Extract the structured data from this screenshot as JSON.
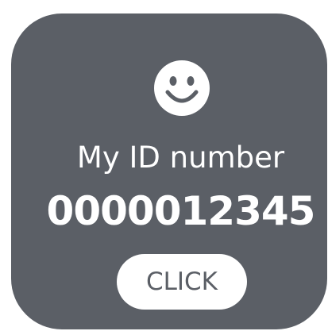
{
  "card": {
    "icon": "smiley-face-icon",
    "label": "My ID number",
    "id_number": "0000012345",
    "button_label": "CLICK"
  },
  "colors": {
    "card_background": "#5b5f66",
    "foreground": "#ffffff",
    "button_text": "#5b5f66"
  }
}
